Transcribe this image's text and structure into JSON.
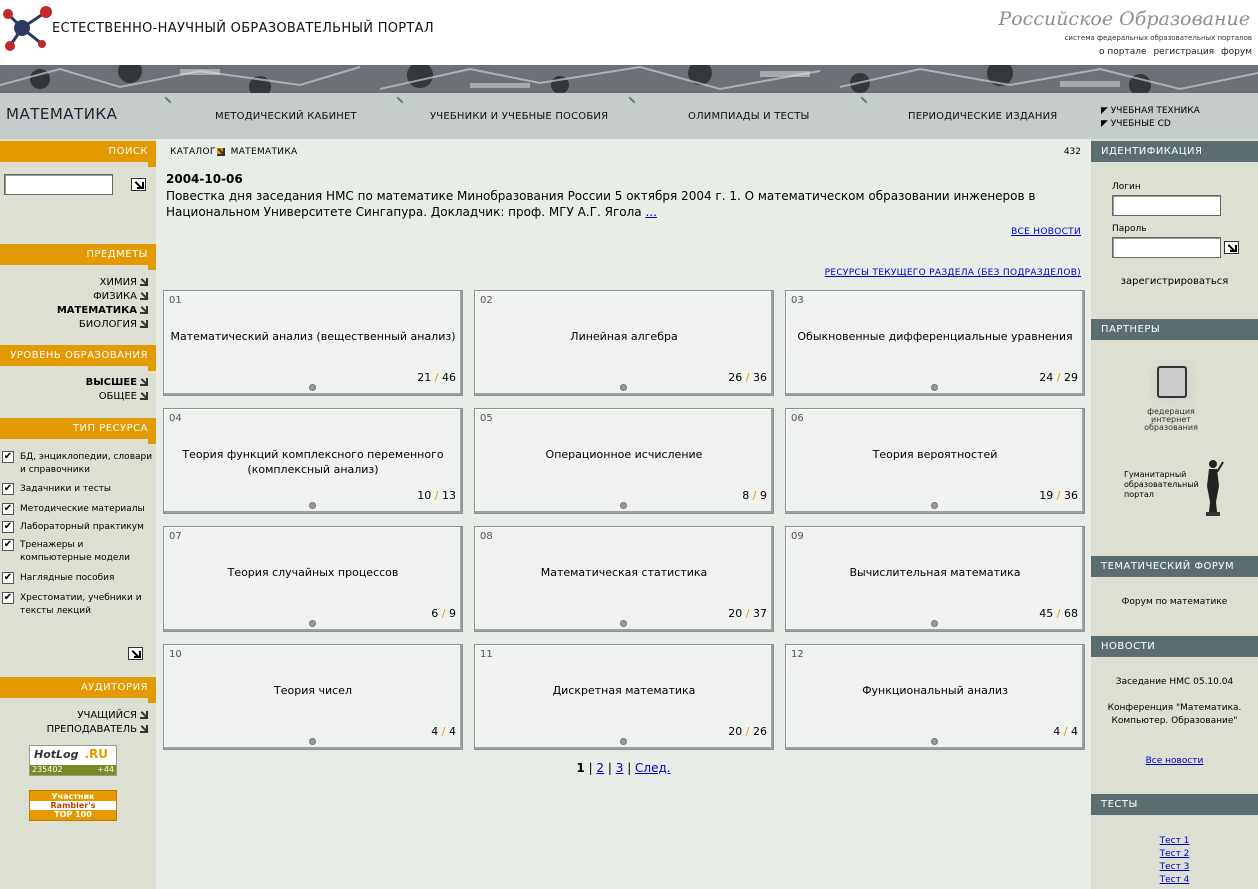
{
  "header": {
    "site_title": "ЕСТЕСТВЕННО-НАУЧНЫЙ ОБРАЗОВАТЕЛЬНЫЙ ПОРТАЛ",
    "ro_logo": "Российское Образование",
    "ro_subtitle": "система федеральных образовательных порталов",
    "links": [
      "о портале",
      "регистрация",
      "форум"
    ]
  },
  "subject": {
    "title": "МАТЕМАТИКА"
  },
  "topnav": [
    "МЕТОДИЧЕСКИЙ КАБИНЕТ",
    "УЧЕБНИКИ И УЧЕБНЫЕ ПОСОБИЯ",
    "ОЛИМПИАДЫ И ТЕСТЫ",
    "ПЕРИОДИЧЕСКИЕ ИЗДАНИЯ"
  ],
  "right_top": [
    "УЧЕБНАЯ ТЕХНИКА",
    "УЧЕБНЫЕ CD"
  ],
  "left": {
    "search": {
      "header": "ПОИСК",
      "value": ""
    },
    "subjects": {
      "header": "ПРЕДМЕТЫ",
      "items": [
        "ХИМИЯ",
        "ФИЗИКА",
        "МАТЕМАТИКА",
        "БИОЛОГИЯ"
      ]
    },
    "level": {
      "header": "УРОВЕНЬ ОБРАЗОВАНИЯ",
      "items": [
        "ВЫСШЕЕ",
        "ОБЩЕЕ"
      ]
    },
    "restype": {
      "header": "ТИП РЕСУРСА",
      "items": [
        "БД, энциклопедии, словари и справочники",
        "Задачники и тесты",
        "Методические материалы",
        "Лабораторный практикум",
        "Тренажеры и компьютерные модели",
        "Наглядные пособия",
        "Хрестоматии, учебники и тексты лекций"
      ]
    },
    "audience": {
      "header": "АУДИТОРИЯ",
      "items": [
        "УЧАЩИЙСЯ",
        "ПРЕПОДАВАТЕЛЬ"
      ]
    },
    "hotlog": {
      "brand": "HotLog",
      "count": "235402",
      "delta": "+44"
    },
    "rambler": {
      "line1": "Участник",
      "line2": "Rambler's",
      "line3": "TOP 100"
    }
  },
  "main": {
    "breadcrumb": [
      "КАТАЛОГ",
      "МАТЕМАТИКА"
    ],
    "count": "432",
    "news_date": "2004-10-06",
    "news_text": "Повестка дня заседания НМС по математике Минобразования России 5 октября 2004 г. 1. О математическом образовании инженеров в Национальном Университете Сингапура. Докладчик: проф. МГУ А.Г. Ягола",
    "news_more": "...",
    "all_news": "ВСЕ НОВОСТИ",
    "resources_link": "РЕСУРСЫ ТЕКУЩЕГО РАЗДЕЛА (БЕЗ ПОДРАЗДЕЛОВ)",
    "cards": [
      {
        "num": "01",
        "title": "Математический анализ (вещественный анализ)",
        "a": "21",
        "b": "46"
      },
      {
        "num": "02",
        "title": "Линейная алгебра",
        "a": "26",
        "b": "36"
      },
      {
        "num": "03",
        "title": "Обыкновенные дифференциальные уравнения",
        "a": "24",
        "b": "29"
      },
      {
        "num": "04",
        "title": "Теория функций комплексного переменного (комплексный анализ)",
        "a": "10",
        "b": "13"
      },
      {
        "num": "05",
        "title": "Операционное исчисление",
        "a": "8",
        "b": "9"
      },
      {
        "num": "06",
        "title": "Теория вероятностей",
        "a": "19",
        "b": "36"
      },
      {
        "num": "07",
        "title": "Теория случайных процессов",
        "a": "6",
        "b": "9"
      },
      {
        "num": "08",
        "title": "Математическая статистика",
        "a": "20",
        "b": "37"
      },
      {
        "num": "09",
        "title": "Вычислительная математика",
        "a": "45",
        "b": "68"
      },
      {
        "num": "10",
        "title": "Теория чисел",
        "a": "4",
        "b": "4"
      },
      {
        "num": "11",
        "title": "Дискретная математика",
        "a": "20",
        "b": "26"
      },
      {
        "num": "12",
        "title": "Функциональный анализ",
        "a": "4",
        "b": "4"
      }
    ],
    "pager": {
      "current": "1",
      "pages": [
        "2",
        "3"
      ],
      "next": "След."
    }
  },
  "right": {
    "ident": {
      "header": "ИДЕНТИФИКАЦИЯ",
      "login_label": "Логин",
      "password_label": "Пароль",
      "register": "зарегистрироваться"
    },
    "partners": {
      "header": "ПАРТНЕРЫ",
      "fio": "федерация интернет образования",
      "humanitarian": "Гуманитарный образовательный портал"
    },
    "forum": {
      "header": "ТЕМАТИЧЕСКИЙ ФОРУМ",
      "link": "Форум по математике"
    },
    "news": {
      "header": "НОВОСТИ",
      "items": [
        "Заседание НМС 05.10.04",
        "Конференция \"Математика. Компьютер. Образование\""
      ],
      "all": "Все новости"
    },
    "tests": {
      "header": "ТЕСТЫ",
      "items": [
        "Тест 1",
        "Тест 2",
        "Тест 3",
        "Тест 4"
      ]
    }
  }
}
